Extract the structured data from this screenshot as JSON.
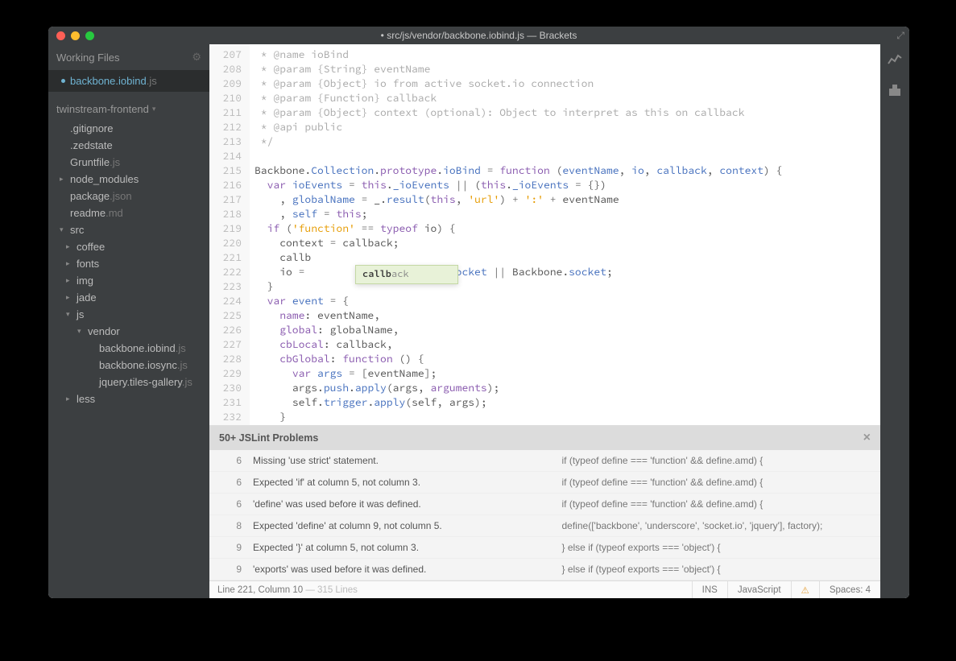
{
  "title": "• src/js/vendor/backbone.iobind.js — Brackets",
  "sidebar": {
    "working_files_label": "Working Files",
    "working_files": [
      {
        "name": "backbone.iobind",
        "ext": ".js",
        "active": true,
        "dirty": true
      }
    ],
    "project_name": "twinstream-frontend",
    "tree": [
      {
        "depth": 0,
        "arrow": "",
        "name": ".gitignore",
        "ext": ""
      },
      {
        "depth": 0,
        "arrow": "",
        "name": ".zedstate",
        "ext": ""
      },
      {
        "depth": 0,
        "arrow": "",
        "name": "Gruntfile",
        "ext": ".js"
      },
      {
        "depth": 0,
        "arrow": "▸",
        "name": "node_modules",
        "ext": ""
      },
      {
        "depth": 0,
        "arrow": "",
        "name": "package",
        "ext": ".json"
      },
      {
        "depth": 0,
        "arrow": "",
        "name": "readme",
        "ext": ".md"
      },
      {
        "depth": 0,
        "arrow": "▾",
        "name": "src",
        "ext": ""
      },
      {
        "depth": 1,
        "arrow": "▸",
        "name": "coffee",
        "ext": ""
      },
      {
        "depth": 1,
        "arrow": "▸",
        "name": "fonts",
        "ext": ""
      },
      {
        "depth": 1,
        "arrow": "▸",
        "name": "img",
        "ext": ""
      },
      {
        "depth": 1,
        "arrow": "▸",
        "name": "jade",
        "ext": ""
      },
      {
        "depth": 1,
        "arrow": "▾",
        "name": "js",
        "ext": ""
      },
      {
        "depth": 2,
        "arrow": "▾",
        "name": "vendor",
        "ext": ""
      },
      {
        "depth": 3,
        "arrow": "",
        "name": "backbone.iobind",
        "ext": ".js"
      },
      {
        "depth": 3,
        "arrow": "",
        "name": "backbone.iosync",
        "ext": ".js"
      },
      {
        "depth": 3,
        "arrow": "",
        "name": "jquery.tiles-gallery",
        "ext": ".js"
      },
      {
        "depth": 1,
        "arrow": "▸",
        "name": "less",
        "ext": ""
      }
    ]
  },
  "editor": {
    "first_line": 207,
    "lines": [
      {
        "html": "<span class='cm'> * @name ioBind</span>"
      },
      {
        "html": "<span class='cm'> * @param {String} eventName</span>"
      },
      {
        "html": "<span class='cm'> * @param {Object} io from active socket.io connection</span>"
      },
      {
        "html": "<span class='cm'> * @param {Function} callback</span>"
      },
      {
        "html": "<span class='cm'> * @param {Object} context (optional): Object to interpret as this on callback</span>"
      },
      {
        "html": "<span class='cm'> * @api public</span>"
      },
      {
        "html": "<span class='cm'> */</span>"
      },
      {
        "html": ""
      },
      {
        "html": "<span class='var'>Backbone</span>.<span class='ident'>Collection</span>.<span class='prop'>prototype</span>.<span class='ident'>ioBind</span> <span class='op'>=</span> <span class='kw'>function</span> (<span class='fn'>eventName</span>, <span class='fn'>io</span>, <span class='fn'>callback</span>, <span class='fn'>context</span>) {"
      },
      {
        "html": "  <span class='kw'>var</span> <span class='ident'>ioEvents</span> <span class='op'>=</span> <span class='kw'>this</span>.<span class='ident'>_ioEvents</span> <span class='op'>||</span> (<span class='kw'>this</span>.<span class='ident'>_ioEvents</span> <span class='op'>=</span> {})"
      },
      {
        "html": "    , <span class='ident'>globalName</span> <span class='op'>=</span> <span class='var'>_</span>.<span class='ident'>result</span>(<span class='kw'>this</span>, <span class='str'>'url'</span>) <span class='op'>+</span> <span class='str'>':'</span> <span class='op'>+</span> <span class='var'>eventName</span>"
      },
      {
        "html": "    , <span class='ident'>self</span> <span class='op'>=</span> <span class='kw'>this</span>;"
      },
      {
        "html": "  <span class='kw'>if</span> (<span class='str'>'function'</span> <span class='op'>==</span> <span class='kw'>typeof</span> <span class='var'>io</span>) {"
      },
      {
        "html": "    <span class='var'>context</span> <span class='op'>=</span> <span class='var'>callback</span>;"
      },
      {
        "html": "    <span class='var'>callb</span>"
      },
      {
        "html": "    <span class='var'>io</span> <span class='op'>=</span>                  <span class='var'>ndow</span>.<span class='ident'>socket</span> <span class='op'>||</span> <span class='var'>Backbone</span>.<span class='ident'>socket</span>;"
      },
      {
        "html": "  }"
      },
      {
        "html": "  <span class='kw'>var</span> <span class='ident'>event</span> <span class='op'>=</span> {"
      },
      {
        "html": "    <span class='prop'>name</span>: <span class='var'>eventName</span>,"
      },
      {
        "html": "    <span class='prop'>global</span>: <span class='var'>globalName</span>,"
      },
      {
        "html": "    <span class='prop'>cbLocal</span>: <span class='var'>callback</span>,"
      },
      {
        "html": "    <span class='prop'>cbGlobal</span>: <span class='kw'>function</span> () {"
      },
      {
        "html": "      <span class='kw'>var</span> <span class='ident'>args</span> <span class='op'>=</span> [<span class='var'>eventName</span>];"
      },
      {
        "html": "      <span class='var'>args</span>.<span class='ident'>push</span>.<span class='ident'>apply</span>(<span class='var'>args</span>, <span class='kw'>arguments</span>);"
      },
      {
        "html": "      <span class='var'>self</span>.<span class='ident'>trigger</span>.<span class='ident'>apply</span>(<span class='var'>self</span>, <span class='var'>args</span>);"
      },
      {
        "html": "    }"
      }
    ],
    "hint_bold": "callb",
    "hint_rest": "ack"
  },
  "problems": {
    "title": "50+ JSLint Problems",
    "rows": [
      {
        "line": "6",
        "msg": "Missing 'use strict' statement.",
        "code": "if (typeof define === 'function' && define.amd) {"
      },
      {
        "line": "6",
        "msg": "Expected 'if' at column 5, not column 3.",
        "code": "if (typeof define === 'function' && define.amd) {"
      },
      {
        "line": "6",
        "msg": "'define' was used before it was defined.",
        "code": "if (typeof define === 'function' && define.amd) {"
      },
      {
        "line": "8",
        "msg": "Expected 'define' at column 9, not column 5.",
        "code": "define(['backbone', 'underscore', 'socket.io', 'jquery'], factory);"
      },
      {
        "line": "9",
        "msg": "Expected '}' at column 5, not column 3.",
        "code": "} else if (typeof exports === 'object') {"
      },
      {
        "line": "9",
        "msg": "'exports' was used before it was defined.",
        "code": "} else if (typeof exports === 'object') {"
      }
    ]
  },
  "status": {
    "cursor": "Line 221, Column 10",
    "total": " — 315 Lines",
    "ins": "INS",
    "lang": "JavaScript",
    "spaces": "Spaces:  4"
  }
}
